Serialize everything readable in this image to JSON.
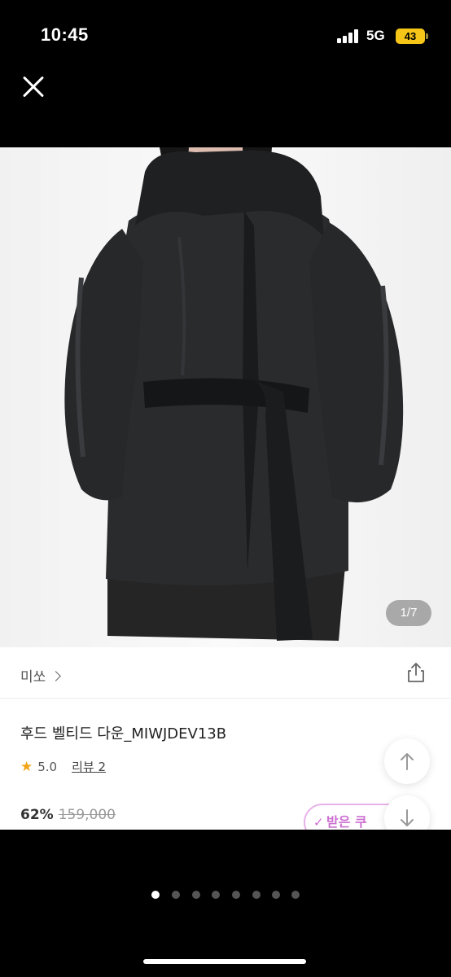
{
  "status_bar": {
    "time": "10:45",
    "network": "5G",
    "battery": "43"
  },
  "product": {
    "image_counter": "1/7",
    "brand": "미쏘",
    "title": "후드 벨티드 다운_MIWJDEV13B",
    "rating": "5.0",
    "reviews_label": "리뷰 2",
    "discount": "62%",
    "original_price": "159,000",
    "coupon_label": "받은 쿠"
  },
  "pager": {
    "total": 8,
    "active_index": 0
  },
  "icons": [
    "close-icon",
    "share-icon",
    "star-icon",
    "arrow-up-icon",
    "arrow-down-icon",
    "chevron-right-icon"
  ],
  "colors": {
    "background": "#000000",
    "sheet": "#ffffff",
    "star": "#f2a516",
    "battery": "#f5c518",
    "coupon": "#cc6fd1"
  }
}
